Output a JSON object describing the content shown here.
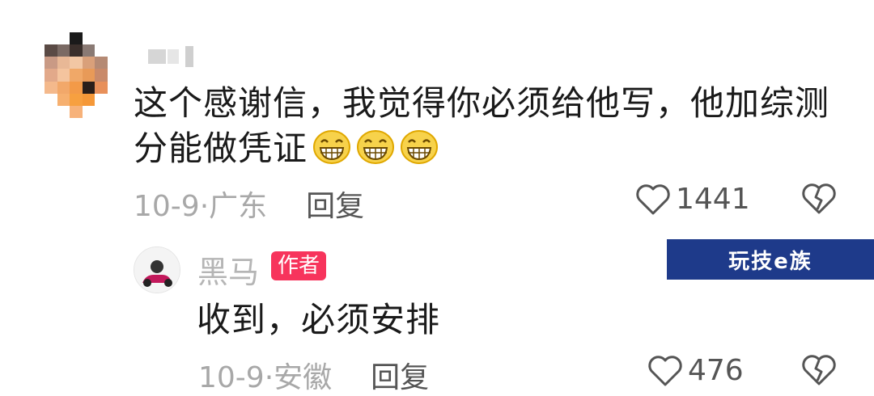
{
  "comment": {
    "text": "这个感谢信，我觉得你必须给他写，他加综测分能做凭证",
    "emoji": [
      "grinning-face",
      "grinning-face",
      "grinning-face"
    ],
    "date": "10-9",
    "location": "广东",
    "reply_label": "回复",
    "like_count": "1441"
  },
  "reply": {
    "author_name": "黑马",
    "author_badge": "作者",
    "text": "收到，必须安排",
    "date": "10-9",
    "location": "安徽",
    "reply_label": "回复",
    "like_count": "476"
  },
  "watermark": {
    "text": "玩技e族"
  },
  "colors": {
    "badge": "#f7345c",
    "meta": "#a8a8a8",
    "watermark_bg": "#1e3a8a"
  }
}
